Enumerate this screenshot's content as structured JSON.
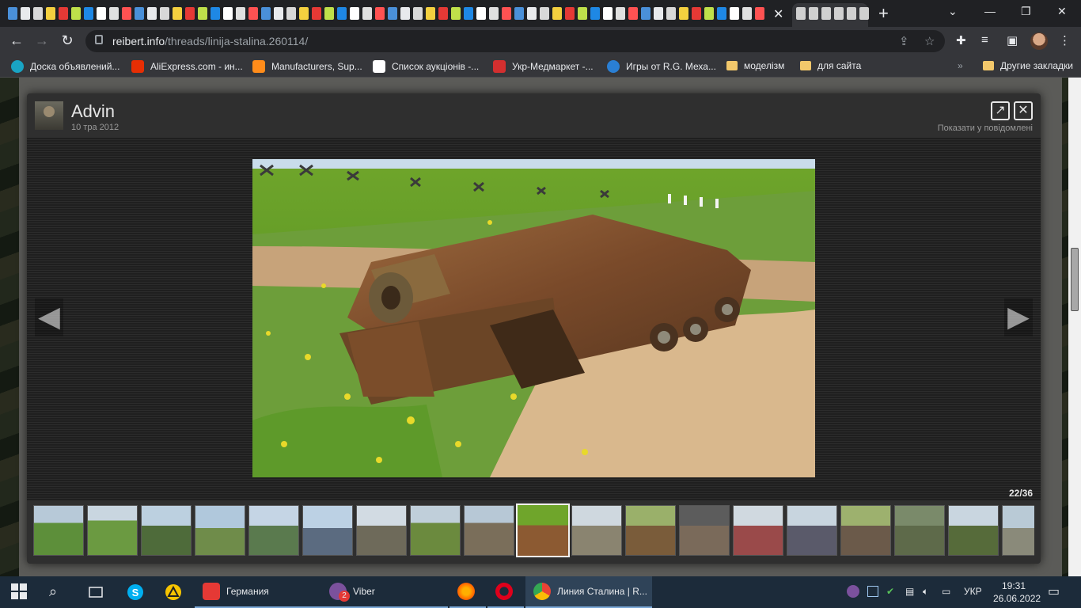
{
  "browser": {
    "url_host": "reibert.info",
    "url_path": "/threads/linija-stalina.260114/",
    "tab_close": "✕",
    "new_tab": "+"
  },
  "bookmarks": [
    {
      "label": "Доска объявлений...",
      "color": "#19a4c4"
    },
    {
      "label": "AliExpress.com - ин...",
      "color": "#e62e04"
    },
    {
      "label": "Manufacturers, Sup...",
      "color": "#ff8c1a"
    },
    {
      "label": "Список аукціонів -...",
      "color": "#ffffff"
    },
    {
      "label": "Укр-Медмаркет -...",
      "color": "#d32f2f"
    },
    {
      "label": "Игры от R.G. Меха...",
      "color": "#2a7fd4"
    },
    {
      "label": "моделізм",
      "folder": true
    },
    {
      "label": "для сайта",
      "folder": true
    },
    {
      "label": "Другие закладки",
      "folder": true
    }
  ],
  "lightbox": {
    "username": "Advin",
    "date": "10 тра 2012",
    "show_in_post": "Показати у повідомлені",
    "counter": "22/36",
    "prev_label": "◀",
    "next_label": "▶",
    "thumb_count": 19,
    "active_thumb": 9
  },
  "taskbar": {
    "items": [
      {
        "label": "Германия",
        "color": "#e53935"
      },
      {
        "label": "Viber",
        "color": "#7b519d",
        "badge": "2"
      },
      {
        "label": "",
        "color": "#ff7139"
      },
      {
        "label": "",
        "color": "#e0001b"
      },
      {
        "label": "Линия Сталина | R...",
        "color": "#4285f4"
      }
    ],
    "lang": "УКР",
    "time": "19:31",
    "date": "26.06.2022"
  }
}
